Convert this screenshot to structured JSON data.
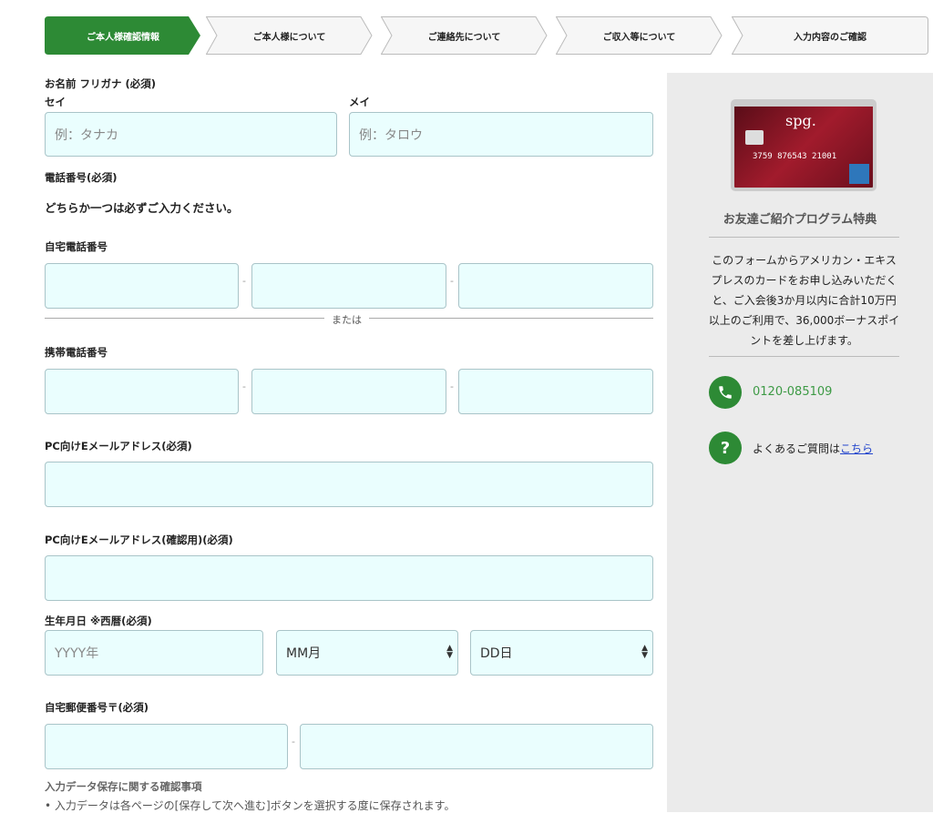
{
  "steps": [
    "ご本人様確認情報",
    "ご本人様について",
    "ご連絡先について",
    "ご収入等について",
    "入力内容のご確認"
  ],
  "name": {
    "label": "お名前 フリガナ (必須)",
    "sei_label": "セイ",
    "mei_label": "メイ",
    "sei_placeholder": "例：タナカ",
    "mei_placeholder": "例：タロウ"
  },
  "phone": {
    "label": "電話番号(必須)",
    "note": "どちらか一つは必ずご入力ください。",
    "home_label": "自宅電話番号",
    "or": "または",
    "mobile_label": "携帯電話番号",
    "sep": "-"
  },
  "email": {
    "label": "PC向けEメールアドレス(必須)",
    "confirm_label": "PC向けEメールアドレス(確認用)(必須)"
  },
  "birth": {
    "label": "生年月日 ※西暦(必須)",
    "year_placeholder": "YYYY年",
    "month": "MM月",
    "day": "DD日"
  },
  "zip": {
    "label": "自宅郵便番号〒(必須)"
  },
  "save_notice": {
    "title": "入力データ保存に関する確認事項",
    "item": "入力データは各ページの[保存して次へ進む]ボタンを選択する度に保存されます。"
  },
  "sidebar": {
    "card_brand": "AMERICAN EXPRESS",
    "card_logo": "spg.",
    "card_number": "3759 876543 21001",
    "title": "お友達ご紹介プログラム特典",
    "body": "このフォームからアメリカン・エキスプレスのカードをお申し込みいただくと、ご入会後3か月以内に合計10万円以上のご利用で、36,000ボーナスポイントを差し上げます。",
    "phone": "0120-085109",
    "faq_text": "よくあるご質問は",
    "faq_link": "こちら"
  },
  "colors": {
    "accent": "#2d8a35",
    "input_bg": "#eafefe",
    "sidebar_bg": "#ebebeb"
  }
}
